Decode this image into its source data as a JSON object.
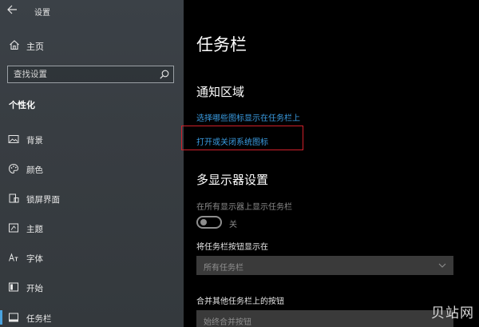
{
  "window": {
    "title": "设置"
  },
  "sidebar": {
    "home_label": "主页",
    "search_placeholder": "查找设置",
    "section_title": "个性化",
    "items": [
      {
        "label": "背景",
        "icon": "image-icon"
      },
      {
        "label": "颜色",
        "icon": "palette-icon"
      },
      {
        "label": "锁屏界面",
        "icon": "lock-screen-icon"
      },
      {
        "label": "主题",
        "icon": "theme-icon"
      },
      {
        "label": "字体",
        "icon": "font-icon"
      },
      {
        "label": "开始",
        "icon": "start-icon"
      },
      {
        "label": "任务栏",
        "icon": "taskbar-icon"
      }
    ],
    "active_item": "任务栏"
  },
  "main": {
    "page_title": "任务栏",
    "notify_area_title": "通知区域",
    "link_select_icons": "选择哪些图标显示在任务栏上",
    "link_system_icons": "打开或关闭系统图标",
    "multi_display_title": "多显示器设置",
    "show_all_displays_label": "在所有显示器上显示任务栏",
    "toggle_state": "关",
    "show_buttons_label": "将任务栏按钮显示在",
    "show_buttons_value": "所有任务栏",
    "combine_label": "合并其他任务栏上的按钮",
    "combine_value": "始终合并按钮"
  },
  "watermark": "贝站网",
  "colors": {
    "link": "#3a9be0",
    "highlight": "#d0202a",
    "accent": "#4aa3df"
  }
}
